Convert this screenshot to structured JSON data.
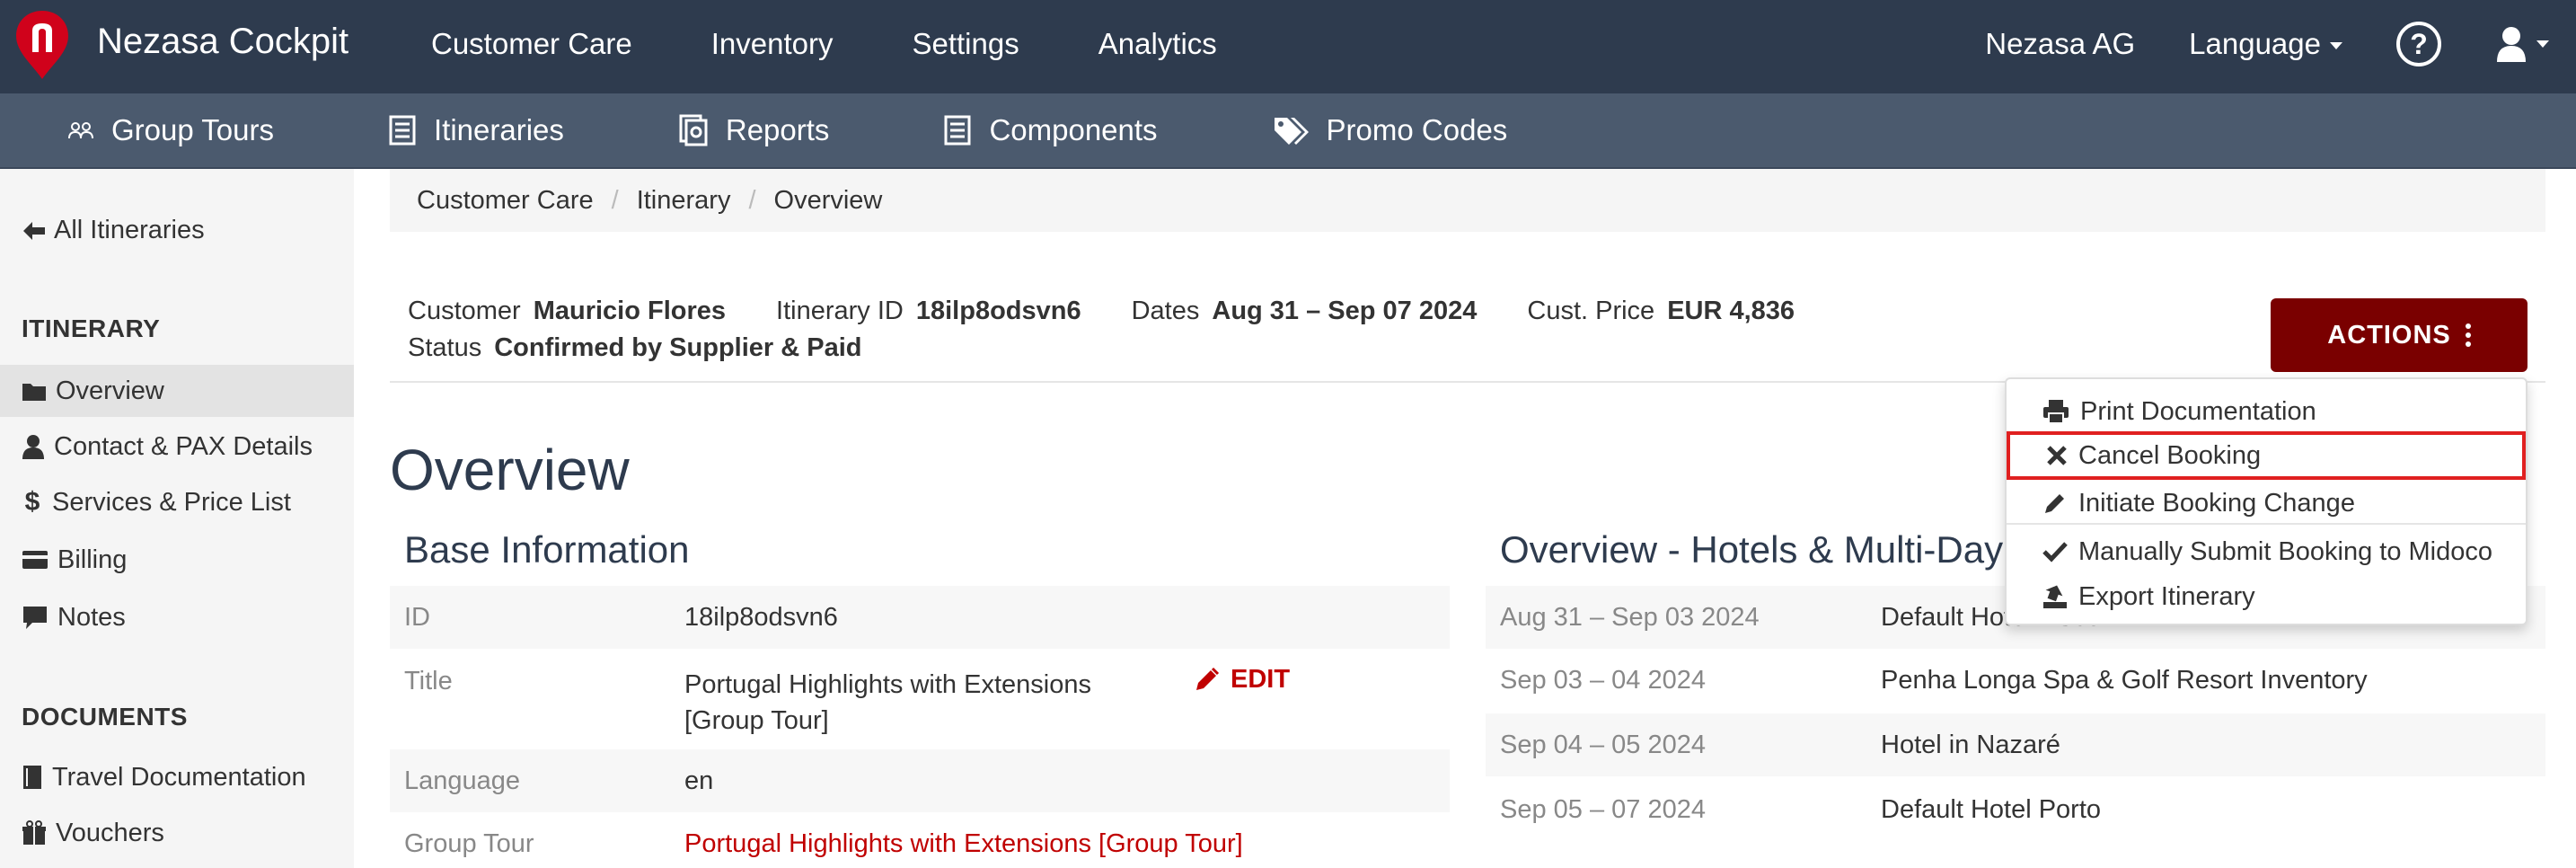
{
  "topbar": {
    "brand": "Nezasa Cockpit",
    "nav": [
      "Customer Care",
      "Inventory",
      "Settings",
      "Analytics"
    ],
    "company": "Nezasa AG",
    "language": "Language",
    "help_icon": "question-circle-icon",
    "user_icon": "user-icon",
    "color": "#2e3b4e"
  },
  "subnav": {
    "items": [
      {
        "label": "Group Tours",
        "icon": "group-icon"
      },
      {
        "label": "Itineraries",
        "icon": "list-icon"
      },
      {
        "label": "Reports",
        "icon": "reports-icon"
      },
      {
        "label": "Components",
        "icon": "list-icon"
      },
      {
        "label": "Promo Codes",
        "icon": "tags-icon"
      }
    ],
    "color": "#4b5a6e"
  },
  "sidebar": {
    "back": "All Itineraries",
    "itinerary_heading": "ITINERARY",
    "itinerary_items": [
      "Overview",
      "Contact & PAX Details",
      "Services & Price List",
      "Billing",
      "Notes"
    ],
    "documents_heading": "DOCUMENTS",
    "document_items": [
      "Travel Documentation",
      "Vouchers"
    ]
  },
  "breadcrumb": [
    "Customer Care",
    "Itinerary",
    "Overview"
  ],
  "info": {
    "customer_label": "Customer",
    "customer": "Mauricio Flores",
    "itinerary_id_label": "Itinerary ID",
    "itinerary_id": "18ilp8odsvn6",
    "dates_label": "Dates",
    "dates": "Aug 31 – Sep 07 2024",
    "price_label": "Cust. Price",
    "price": "EUR 4,836",
    "status_label": "Status",
    "status": "Confirmed by Supplier & Paid"
  },
  "actions": {
    "label": "ACTIONS",
    "color": "#7a0000",
    "menu": [
      "Print Documentation",
      "Cancel Booking",
      "Initiate Booking Change",
      "Manually Submit Booking to Midoco",
      "Export Itinerary"
    ]
  },
  "page_title": "Overview",
  "base_info": {
    "title": "Base Information",
    "rows": [
      {
        "key": "ID",
        "value": "18ilp8odsvn6"
      },
      {
        "key": "Title",
        "value": "Portugal Highlights with Extensions",
        "value2": "[Group Tour]"
      },
      {
        "key": "Language",
        "value": "en"
      },
      {
        "key": "Group Tour",
        "value": "Portugal Highlights with Extensions [Group Tour]"
      }
    ],
    "edit": "EDIT"
  },
  "hotels": {
    "title": "Overview - Hotels & Multi-Day",
    "rows": [
      {
        "dates": "Aug 31 – Sep 03 2024",
        "hotel": "Default Hotel Lisbon"
      },
      {
        "dates": "Sep 03 – 04 2024",
        "hotel": "Penha Longa Spa & Golf Resort Inventory"
      },
      {
        "dates": "Sep 04 – 05 2024",
        "hotel": "Hotel in Nazaré"
      },
      {
        "dates": "Sep 05 – 07 2024",
        "hotel": "Default Hotel Porto"
      }
    ]
  }
}
